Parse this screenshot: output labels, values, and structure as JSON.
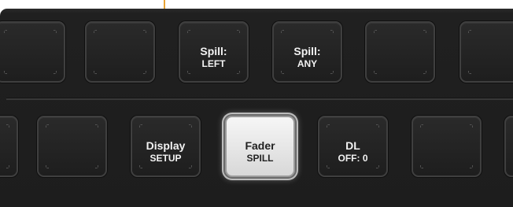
{
  "accent_color": "#e7a233",
  "top_row": [
    {
      "line1": "",
      "line2": ""
    },
    {
      "line1": "",
      "line2": ""
    },
    {
      "line1": "Spill:",
      "line2": "LEFT"
    },
    {
      "line1": "Spill:",
      "line2": "ANY"
    },
    {
      "line1": "",
      "line2": ""
    },
    {
      "line1": "",
      "line2": ""
    }
  ],
  "bottom_row": [
    {
      "line1": "",
      "line2": ""
    },
    {
      "line1": "",
      "line2": ""
    },
    {
      "line1": "Display",
      "line2": "SETUP"
    },
    {
      "line1": "Fader",
      "line2": "SPILL",
      "lit": true
    },
    {
      "line1": "DL",
      "line2": "OFF: 0"
    },
    {
      "line1": "",
      "line2": ""
    },
    {
      "line1": "",
      "line2": ""
    }
  ]
}
